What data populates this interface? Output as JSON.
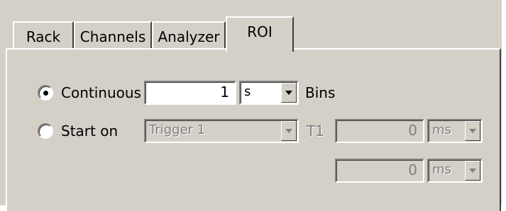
{
  "tabs": [
    {
      "label": "Rack"
    },
    {
      "label": "Channels"
    },
    {
      "label": "Analyzer"
    },
    {
      "label": "ROI",
      "active": true
    }
  ],
  "roi": {
    "continuous": {
      "label": "Continuous",
      "selected": true,
      "value": "1",
      "unit": "s",
      "suffix": "Bins"
    },
    "start_on": {
      "label": "Start on",
      "selected": false,
      "trigger": "Trigger 1",
      "t1_label": "T1",
      "t1_value": "0",
      "t1_unit": "ms",
      "t2_value": "0",
      "t2_unit": "ms"
    }
  }
}
